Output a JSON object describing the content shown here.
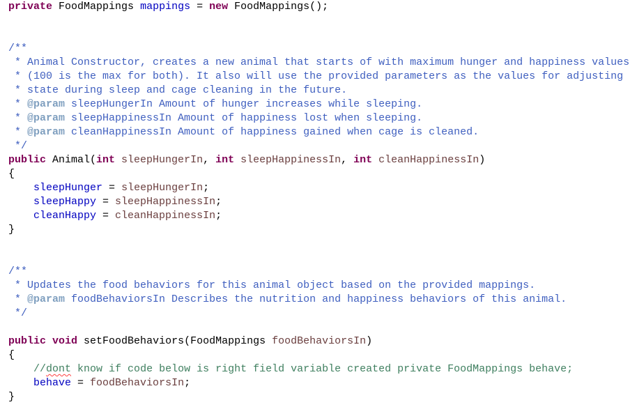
{
  "editor": {
    "field_decl": {
      "modifier": "private",
      "type": "FoodMappings",
      "name": "mappings",
      "op": " = ",
      "new_kw": "new",
      "init": " FoodMappings();"
    },
    "constructor_doc": {
      "open": "/**",
      "lines": [
        " * Animal Constructor, creates a new animal that starts of with maximum hunger and happiness values",
        " * (100 is the max for both). It also will use the provided parameters as the values for adjusting",
        " * state during sleep and cage cleaning in the future."
      ],
      "params": [
        {
          "tag": "@param",
          "text": " sleepHungerIn Amount of hunger increases while sleeping."
        },
        {
          "tag": "@param",
          "text": " sleepHappinessIn Amount of happiness lost when sleeping."
        },
        {
          "tag": "@param",
          "text": " cleanHappinessIn Amount of happiness gained when cage is cleaned."
        }
      ],
      "close": " */"
    },
    "constructor": {
      "modifier": "public",
      "name": " Animal(",
      "int_kw": "int",
      "p1": " sleepHungerIn",
      "p2": " sleepHappinessIn",
      "p3": " cleanHappinessIn",
      "sep": ", ",
      "close_paren": ")",
      "open_brace": "{",
      "close_brace": "}",
      "body": [
        {
          "field": "sleepHunger",
          "op": " = ",
          "value": "sleepHungerIn",
          "end": ";"
        },
        {
          "field": "sleepHappy",
          "op": " = ",
          "value": "sleepHappinessIn",
          "end": ";"
        },
        {
          "field": "cleanHappy",
          "op": " = ",
          "value": "cleanHappinessIn",
          "end": ";"
        }
      ]
    },
    "setter_doc": {
      "open": "/**",
      "line": " * Updates the food behaviors for this animal object based on the provided mappings.",
      "param_prefix": " * ",
      "param_tag": "@param",
      "param_text": " foodBehaviorsIn Describes the nutrition and happiness behaviors of this animal.",
      "close": " */"
    },
    "setter": {
      "modifier": "public",
      "void_kw": "void",
      "name": " setFoodBehaviors(FoodMappings ",
      "param": "foodBehaviorsIn",
      "close_paren": ")",
      "open_brace": "{",
      "close_brace": "}",
      "comment_prefix": "//",
      "comment_misspelled": "dont",
      "comment_rest": " know if code below is right field variable created private FoodMappings behave;",
      "assign_field": "behave",
      "assign_op": " = ",
      "assign_value": "foodBehaviorsIn",
      "assign_end": ";"
    },
    "doc_star_prefix": " * ",
    "indent": "    ",
    "space": " "
  }
}
